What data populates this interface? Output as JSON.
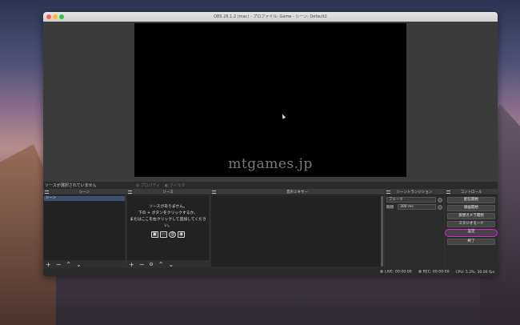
{
  "window": {
    "title": "OBS 26.1.2 (mac) - プロファイル: Game - シーン: Default2"
  },
  "preview": {
    "watermark": "mtgames.jp"
  },
  "source_toolbar": {
    "no_source_selected": "ソースが選択されていません",
    "properties": "プロパティ",
    "filters": "フィルタ"
  },
  "docks": {
    "scenes": {
      "title": "シーン",
      "items": [
        "シーン"
      ]
    },
    "sources": {
      "title": "ソース",
      "empty_message": "ソースがありません。\n下の + ボタンをクリックするか、\nまたはここを右クリックして追加してください。",
      "icons": [
        "image-icon",
        "monitor-icon",
        "globe-icon",
        "camera-icon"
      ]
    },
    "mixer": {
      "title": "音声ミキサー"
    },
    "transitions": {
      "title": "シーントランジション",
      "selected": "フェード",
      "duration_label": "期間",
      "duration_value": "300 ms"
    },
    "controls": {
      "title": "コントロール",
      "buttons": [
        "配信開始",
        "録画開始",
        "仮想カメラ開始",
        "スタジオモード",
        "設定",
        "終了"
      ],
      "highlighted": "設定"
    }
  },
  "footer_buttons": {
    "add": "+",
    "remove": "−",
    "up": "⌃",
    "down": "⌄",
    "settings": "⚙"
  },
  "status": {
    "live": "LIVE: 00:00:00",
    "rec": "REC: 00:00:00",
    "cpu": "CPU: 5.2%, 30.00 fps"
  },
  "colors": {
    "highlight": "#e21ee0",
    "selected_scene": "#3b4f6e"
  }
}
